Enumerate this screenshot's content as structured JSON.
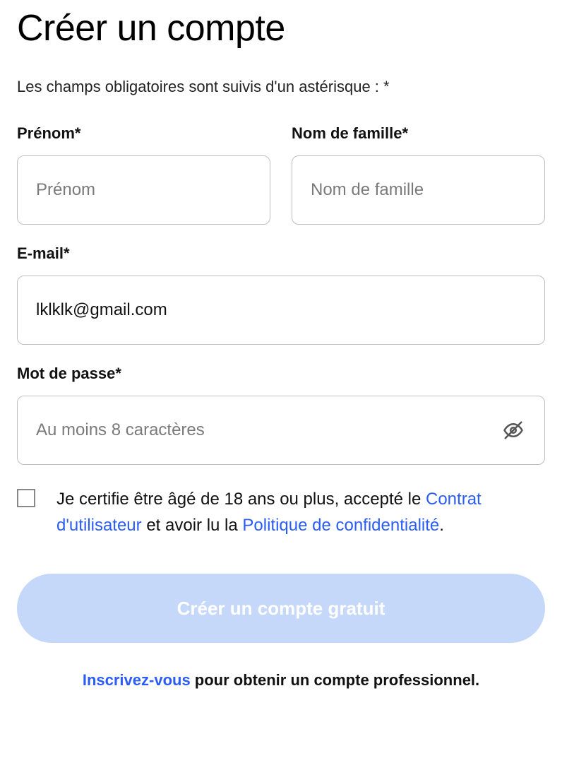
{
  "title": "Créer un compte",
  "required_note": "Les champs obligatoires sont suivis d'un astérisque : *",
  "fields": {
    "first_name": {
      "label": "Prénom*",
      "placeholder": "Prénom",
      "value": ""
    },
    "last_name": {
      "label": "Nom de famille*",
      "placeholder": "Nom de famille",
      "value": ""
    },
    "email": {
      "label": "E-mail*",
      "placeholder": "",
      "value": "lklklk@gmail.com"
    },
    "password": {
      "label": "Mot de passe*",
      "placeholder": "Au moins 8 caractères",
      "value": ""
    }
  },
  "consent": {
    "text_before_link1": "Je certifie être âgé de 18 ans ou plus, accepté le ",
    "link1": "Contrat d'utilisateur",
    "text_between": " et avoir lu la ",
    "link2": "Politique de confidentialité",
    "text_after": "."
  },
  "submit_label": "Créer un compte gratuit",
  "pro": {
    "link": "Inscrivez-vous",
    "text": " pour obtenir un compte professionnel."
  }
}
